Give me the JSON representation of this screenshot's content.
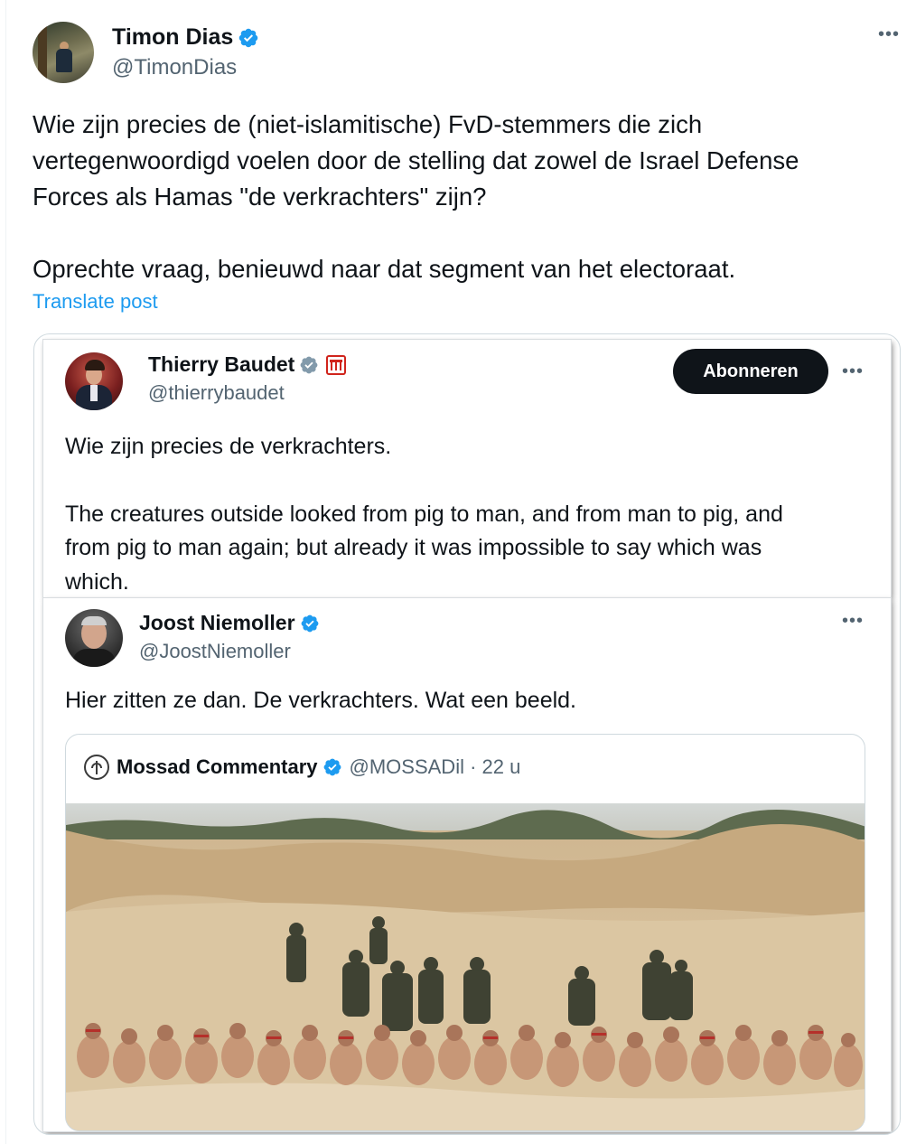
{
  "main_post": {
    "author_name": "Timon Dias",
    "author_handle": "@TimonDias",
    "text_lines": [
      "Wie zijn precies de (niet-islamitische) FvD-stemmers die zich",
      "vertegenwoordigd voelen door de stelling dat zowel de Israel Defense",
      "Forces als Hamas \"de verkrachters\" zijn?"
    ],
    "text_second": "Oprechte vraag, benieuwd naar dat segment van het electoraat.",
    "translate_label": "Translate post",
    "more_icon": "more-icon",
    "verified_color": "#1d9bf0"
  },
  "quoted_baudet": {
    "author_name": "Thierry Baudet",
    "author_handle": "@thierrybaudet",
    "subscribe_label": "Abonneren",
    "text_first": "Wie zijn precies de verkrachters.",
    "text_second_lines": [
      "The creatures outside looked from pig to man, and from man to pig, and",
      "from pig to man again; but already it was impossible to say which was",
      "which."
    ],
    "verified_color": "#829aab",
    "badge_icon": "government-building-icon"
  },
  "quoted_niemoller": {
    "author_name": "Joost Niemoller",
    "author_handle": "@JoostNiemoller",
    "text": "Hier zitten ze dan. De verkrachters. Wat een beeld.",
    "verified_color": "#1d9bf0"
  },
  "inner_quote": {
    "author_name": "Mossad Commentary",
    "author_handle_time": "@MOSSADil · 22 u",
    "logo_icon": "mossad-emblem-icon",
    "photo_icon": "photo-detainees-desert"
  },
  "colors": {
    "link": "#1d9bf0",
    "secondary_text": "#536471",
    "primary_text": "#0f1419",
    "border": "#cfd9de"
  }
}
